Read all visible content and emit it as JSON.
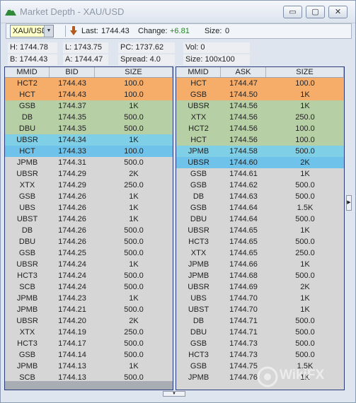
{
  "window": {
    "title": "Market Depth - XAU/USD",
    "minimize": "▭",
    "maximize": "▢",
    "close": "✕"
  },
  "toolbar": {
    "symbol": "XAU/USD",
    "last_label": "Last:",
    "last_value": "1744.43",
    "change_label": "Change:",
    "change_value": "+6.81",
    "change_color": "#1e8a1e",
    "size_label": "Size:",
    "size_value": "0"
  },
  "info": {
    "high": "H: 1744.78",
    "low": "L: 1743.75",
    "pc": "PC: 1737.62",
    "vol": "Vol: 0",
    "bid": "B: 1744.43",
    "ask": "A: 1744.47",
    "spread": "Spread: 4.0",
    "size": "Size: 100x100"
  },
  "colors": {
    "orange": "#f6ad6a",
    "green": "#b7cfa5",
    "cyan": "#7fcfe6",
    "blue": "#6fc3ea",
    "gray": "#d6d6d6"
  },
  "bid_book": {
    "headers": [
      "MMID",
      "BID",
      "SIZE"
    ],
    "rows": [
      {
        "mmid": "HCT2",
        "price": "1744.43",
        "size": "100.0",
        "bg": "orange"
      },
      {
        "mmid": "HCT",
        "price": "1744.43",
        "size": "100.0",
        "bg": "orange"
      },
      {
        "mmid": "GSB",
        "price": "1744.37",
        "size": "1K",
        "bg": "green"
      },
      {
        "mmid": "DB",
        "price": "1744.35",
        "size": "500.0",
        "bg": "green"
      },
      {
        "mmid": "DBU",
        "price": "1744.35",
        "size": "500.0",
        "bg": "green"
      },
      {
        "mmid": "UBSR",
        "price": "1744.34",
        "size": "1K",
        "bg": "cyan"
      },
      {
        "mmid": "HCT",
        "price": "1744.33",
        "size": "100.0",
        "bg": "blue"
      },
      {
        "mmid": "JPMB",
        "price": "1744.31",
        "size": "500.0",
        "bg": "gray"
      },
      {
        "mmid": "UBSR",
        "price": "1744.29",
        "size": "2K",
        "bg": "gray"
      },
      {
        "mmid": "XTX",
        "price": "1744.29",
        "size": "250.0",
        "bg": "gray"
      },
      {
        "mmid": "GSB",
        "price": "1744.26",
        "size": "1K",
        "bg": "gray"
      },
      {
        "mmid": "UBS",
        "price": "1744.26",
        "size": "1K",
        "bg": "gray"
      },
      {
        "mmid": "UBST",
        "price": "1744.26",
        "size": "1K",
        "bg": "gray"
      },
      {
        "mmid": "DB",
        "price": "1744.26",
        "size": "500.0",
        "bg": "gray"
      },
      {
        "mmid": "DBU",
        "price": "1744.26",
        "size": "500.0",
        "bg": "gray"
      },
      {
        "mmid": "GSB",
        "price": "1744.25",
        "size": "500.0",
        "bg": "gray"
      },
      {
        "mmid": "UBSR",
        "price": "1744.24",
        "size": "1K",
        "bg": "gray"
      },
      {
        "mmid": "HCT3",
        "price": "1744.24",
        "size": "500.0",
        "bg": "gray"
      },
      {
        "mmid": "SCB",
        "price": "1744.24",
        "size": "500.0",
        "bg": "gray"
      },
      {
        "mmid": "JPMB",
        "price": "1744.23",
        "size": "1K",
        "bg": "gray"
      },
      {
        "mmid": "JPMB",
        "price": "1744.21",
        "size": "500.0",
        "bg": "gray"
      },
      {
        "mmid": "UBSR",
        "price": "1744.20",
        "size": "2K",
        "bg": "gray"
      },
      {
        "mmid": "XTX",
        "price": "1744.19",
        "size": "250.0",
        "bg": "gray"
      },
      {
        "mmid": "HCT3",
        "price": "1744.17",
        "size": "500.0",
        "bg": "gray"
      },
      {
        "mmid": "GSB",
        "price": "1744.14",
        "size": "500.0",
        "bg": "gray"
      },
      {
        "mmid": "JPMB",
        "price": "1744.13",
        "size": "1K",
        "bg": "gray"
      },
      {
        "mmid": "SCB",
        "price": "1744.13",
        "size": "500.0",
        "bg": "gray"
      }
    ]
  },
  "ask_book": {
    "headers": [
      "MMID",
      "ASK",
      "SIZE"
    ],
    "rows": [
      {
        "mmid": "HCT",
        "price": "1744.47",
        "size": "100.0",
        "bg": "orange"
      },
      {
        "mmid": "GSB",
        "price": "1744.50",
        "size": "1K",
        "bg": "orange"
      },
      {
        "mmid": "UBSR",
        "price": "1744.56",
        "size": "1K",
        "bg": "green"
      },
      {
        "mmid": "XTX",
        "price": "1744.56",
        "size": "250.0",
        "bg": "green"
      },
      {
        "mmid": "HCT2",
        "price": "1744.56",
        "size": "100.0",
        "bg": "green"
      },
      {
        "mmid": "HCT",
        "price": "1744.56",
        "size": "100.0",
        "bg": "green"
      },
      {
        "mmid": "JPMB",
        "price": "1744.58",
        "size": "500.0",
        "bg": "cyan"
      },
      {
        "mmid": "UBSR",
        "price": "1744.60",
        "size": "2K",
        "bg": "blue"
      },
      {
        "mmid": "GSB",
        "price": "1744.61",
        "size": "1K",
        "bg": "gray"
      },
      {
        "mmid": "GSB",
        "price": "1744.62",
        "size": "500.0",
        "bg": "gray"
      },
      {
        "mmid": "DB",
        "price": "1744.63",
        "size": "500.0",
        "bg": "gray"
      },
      {
        "mmid": "GSB",
        "price": "1744.64",
        "size": "1.5K",
        "bg": "gray"
      },
      {
        "mmid": "DBU",
        "price": "1744.64",
        "size": "500.0",
        "bg": "gray"
      },
      {
        "mmid": "UBSR",
        "price": "1744.65",
        "size": "1K",
        "bg": "gray"
      },
      {
        "mmid": "HCT3",
        "price": "1744.65",
        "size": "500.0",
        "bg": "gray"
      },
      {
        "mmid": "XTX",
        "price": "1744.65",
        "size": "250.0",
        "bg": "gray"
      },
      {
        "mmid": "JPMB",
        "price": "1744.66",
        "size": "1K",
        "bg": "gray"
      },
      {
        "mmid": "JPMB",
        "price": "1744.68",
        "size": "500.0",
        "bg": "gray"
      },
      {
        "mmid": "UBSR",
        "price": "1744.69",
        "size": "2K",
        "bg": "gray"
      },
      {
        "mmid": "UBS",
        "price": "1744.70",
        "size": "1K",
        "bg": "gray"
      },
      {
        "mmid": "UBST",
        "price": "1744.70",
        "size": "1K",
        "bg": "gray"
      },
      {
        "mmid": "DB",
        "price": "1744.71",
        "size": "500.0",
        "bg": "gray"
      },
      {
        "mmid": "DBU",
        "price": "1744.71",
        "size": "500.0",
        "bg": "gray"
      },
      {
        "mmid": "GSB",
        "price": "1744.73",
        "size": "500.0",
        "bg": "gray"
      },
      {
        "mmid": "HCT3",
        "price": "1744.73",
        "size": "500.0",
        "bg": "gray"
      },
      {
        "mmid": "GSB",
        "price": "1744.75",
        "size": "1.5K",
        "bg": "gray"
      },
      {
        "mmid": "JPMB",
        "price": "1744.76",
        "size": "1K",
        "bg": "gray"
      }
    ]
  },
  "watermark": {
    "text": "WikiFX"
  }
}
